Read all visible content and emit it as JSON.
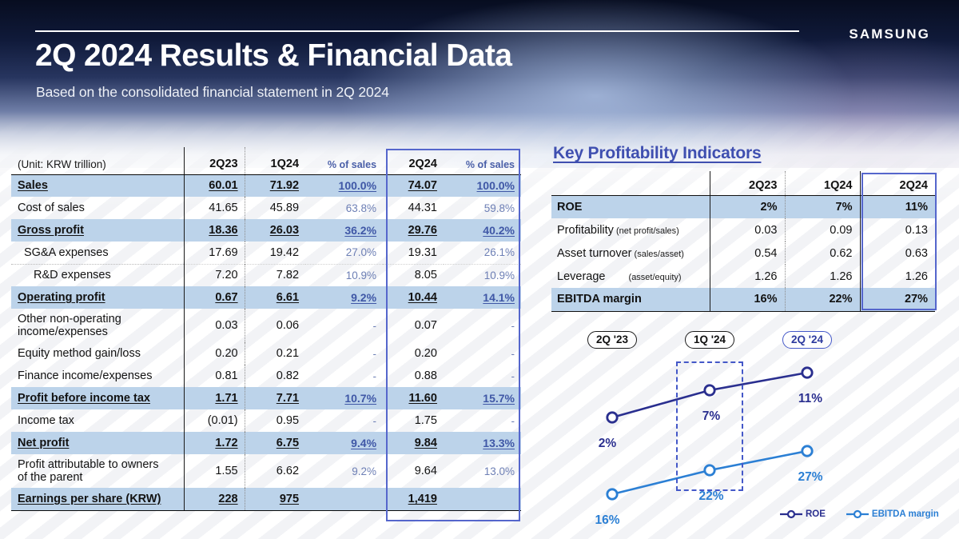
{
  "header": {
    "title": "2Q 2024 Results & Financial Data",
    "subtitle": "Based on the consolidated financial statement in 2Q 2024",
    "logo": "SAMSUNG"
  },
  "colors": {
    "accent_blue": "#3f4fb0",
    "highlight_border": "#5566cc",
    "row_shade": "#bcd3ea",
    "roe_line": "#2a2f8f",
    "ebitda_line": "#2b7fd4",
    "pct_text": "#6d7fb5"
  },
  "income_statement": {
    "unit_label": "(Unit: KRW trillion)",
    "columns": [
      "2Q23",
      "1Q24",
      "% of sales",
      "2Q24",
      "% of sales"
    ],
    "highlighted_column": "2Q24",
    "rows": [
      {
        "label": "Sales",
        "emphasis": "bold",
        "q2q23": "60.01",
        "q1q24": "71.92",
        "pct1q24": "100.0%",
        "q2q24": "74.07",
        "pct2q24": "100.0%"
      },
      {
        "label": "Cost of sales",
        "emphasis": "normal",
        "q2q23": "41.65",
        "q1q24": "45.89",
        "pct1q24": "63.8%",
        "q2q24": "44.31",
        "pct2q24": "59.8%"
      },
      {
        "label": "Gross profit",
        "emphasis": "bold",
        "q2q23": "18.36",
        "q1q24": "26.03",
        "pct1q24": "36.2%",
        "q2q24": "29.76",
        "pct2q24": "40.2%"
      },
      {
        "label": "SG&A expenses",
        "emphasis": "normal",
        "q2q23": "17.69",
        "q1q24": "19.42",
        "pct1q24": "27.0%",
        "q2q24": "19.31",
        "pct2q24": "26.1%"
      },
      {
        "label": "R&D expenses",
        "emphasis": "normal",
        "q2q23": "7.20",
        "q1q24": "7.82",
        "pct1q24": "10.9%",
        "q2q24": "8.05",
        "pct2q24": "10.9%"
      },
      {
        "label": "Operating profit",
        "emphasis": "bold",
        "q2q23": "0.67",
        "q1q24": "6.61",
        "pct1q24": "9.2%",
        "q2q24": "10.44",
        "pct2q24": "14.1%"
      },
      {
        "label_line1": "Other non-operating",
        "label_line2": "income/expenses",
        "emphasis": "normal",
        "q2q23": "0.03",
        "q1q24": "0.06",
        "pct1q24": "-",
        "q2q24": "0.07",
        "pct2q24": "-"
      },
      {
        "label": "Equity method gain/loss",
        "emphasis": "normal",
        "q2q23": "0.20",
        "q1q24": "0.21",
        "pct1q24": "-",
        "q2q24": "0.20",
        "pct2q24": "-"
      },
      {
        "label": "Finance income/expenses",
        "emphasis": "normal",
        "q2q23": "0.81",
        "q1q24": "0.82",
        "pct1q24": "-",
        "q2q24": "0.88",
        "pct2q24": "-"
      },
      {
        "label": "Profit before income tax",
        "emphasis": "bold",
        "q2q23": "1.71",
        "q1q24": "7.71",
        "pct1q24": "10.7%",
        "q2q24": "11.60",
        "pct2q24": "15.7%"
      },
      {
        "label": "Income tax",
        "emphasis": "normal",
        "q2q23": "(0.01)",
        "q1q24": "0.95",
        "pct1q24": "-",
        "q2q24": "1.75",
        "pct2q24": "-"
      },
      {
        "label": "Net profit",
        "emphasis": "bold",
        "q2q23": "1.72",
        "q1q24": "6.75",
        "pct1q24": "9.4%",
        "q2q24": "9.84",
        "pct2q24": "13.3%"
      },
      {
        "label_line1": "Profit attributable to owners",
        "label_line2": "of the parent",
        "emphasis": "normal",
        "q2q23": "1.55",
        "q1q24": "6.62",
        "pct1q24": "9.2%",
        "q2q24": "9.64",
        "pct2q24": "13.0%"
      },
      {
        "label": "Earnings per share (KRW)",
        "emphasis": "bold",
        "q2q23": "228",
        "q1q24": "975",
        "pct1q24": "",
        "q2q24": "1,419",
        "pct2q24": ""
      }
    ]
  },
  "kpi": {
    "title": "Key Profitability Indicators",
    "columns": [
      "",
      "2Q23",
      "1Q24",
      "2Q24"
    ],
    "highlighted_column": "2Q24",
    "rows": [
      {
        "label": "ROE",
        "sub": "",
        "emphasis": "bold",
        "q2q23": "2%",
        "q1q24": "7%",
        "q2q24": "11%"
      },
      {
        "label": "Profitability",
        "sub": "(net profit/sales)",
        "emphasis": "normal",
        "q2q23": "0.03",
        "q1q24": "0.09",
        "q2q24": "0.13"
      },
      {
        "label": "Asset turnover",
        "sub": "(sales/asset)",
        "emphasis": "normal",
        "q2q23": "0.54",
        "q1q24": "0.62",
        "q2q24": "0.63"
      },
      {
        "label": "Leverage",
        "sub": "(asset/equity)",
        "emphasis": "normal",
        "q2q23": "1.26",
        "q1q24": "1.26",
        "q2q24": "1.26"
      },
      {
        "label": "EBITDA margin",
        "sub": "",
        "emphasis": "bold",
        "q2q23": "16%",
        "q1q24": "22%",
        "q2q24": "27%"
      }
    ]
  },
  "chart_data": {
    "type": "line",
    "title": "",
    "categories": [
      "2Q '23",
      "1Q '24",
      "2Q '24"
    ],
    "series": [
      {
        "name": "ROE",
        "values": [
          2,
          7,
          11
        ],
        "labels": [
          "2%",
          "7%",
          "11%"
        ],
        "color": "#2a2f8f"
      },
      {
        "name": "EBITDA margin",
        "values": [
          16,
          22,
          27
        ],
        "labels": [
          "16%",
          "22%",
          "27%"
        ],
        "color": "#2b7fd4"
      }
    ],
    "xlabel": "",
    "ylabel": "",
    "grid": false,
    "legend_position": "bottom-right",
    "legend": [
      "ROE",
      "EBITDA margin"
    ],
    "annotations": [
      "dashed highlight box around 2Q '24 data points"
    ]
  }
}
